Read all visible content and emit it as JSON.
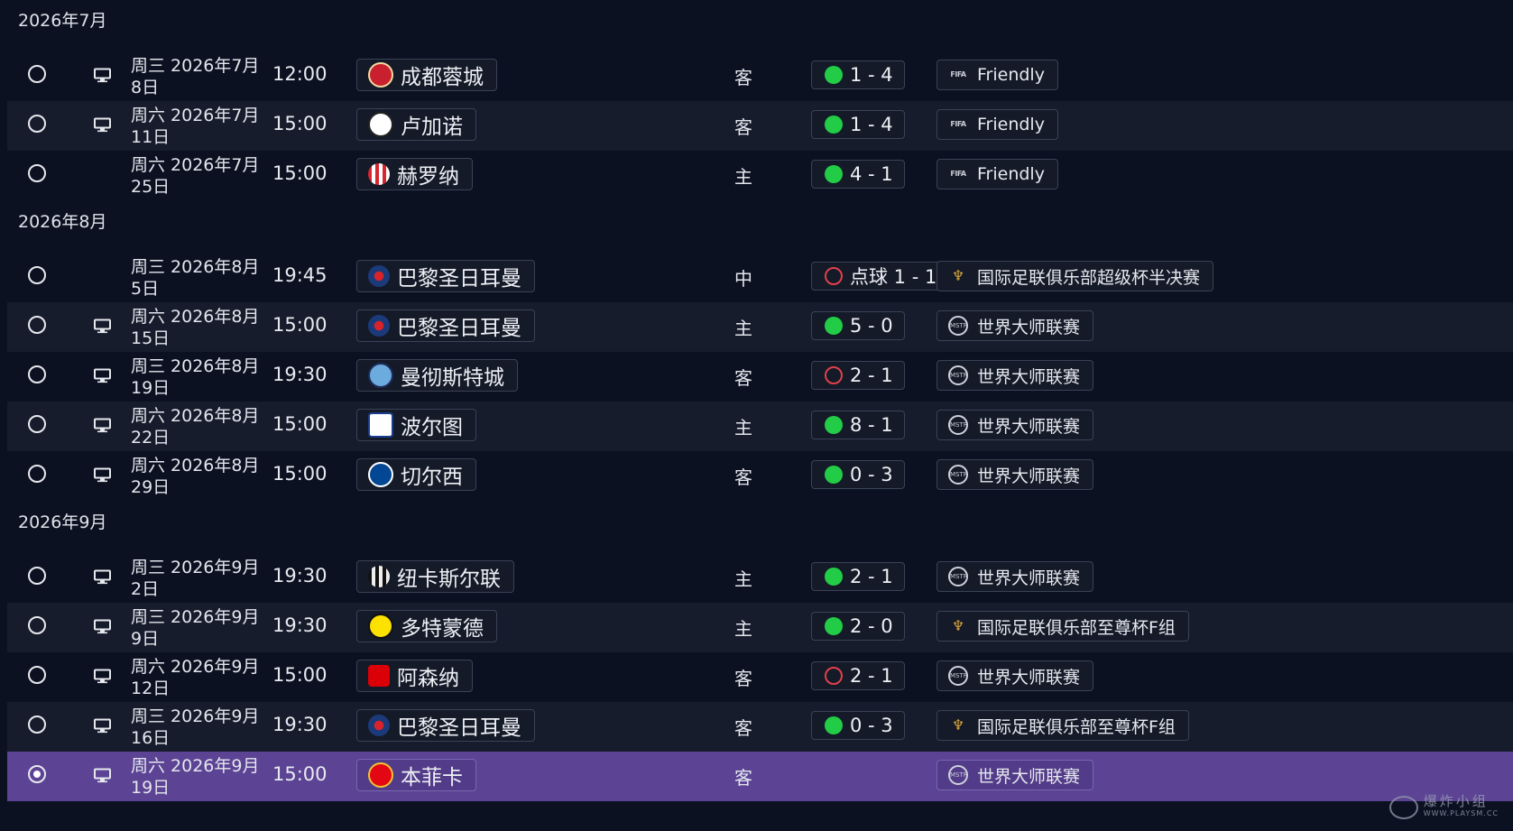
{
  "colors": {
    "win": "#22cc46",
    "loss": "#e0404c",
    "selected_row": "#5c4394",
    "background": "#0b1120"
  },
  "months": [
    {
      "label": "2026年7月",
      "matches": [
        {
          "date": "周三 2026年7月8日",
          "time": "12:00",
          "tv": true,
          "team": "成都蓉城",
          "crest": "chengdu-crest",
          "venue": "客",
          "result": "win",
          "score": "1 - 4",
          "competition": "Friendly",
          "comp_logo": "fifa"
        },
        {
          "date": "周六 2026年7月11日",
          "time": "15:00",
          "tv": true,
          "team": "卢加诺",
          "crest": "lugano-crest",
          "venue": "客",
          "result": "win",
          "score": "1 - 4",
          "competition": "Friendly",
          "comp_logo": "fifa"
        },
        {
          "date": "周六 2026年7月25日",
          "time": "15:00",
          "tv": false,
          "team": "赫罗纳",
          "crest": "girona-crest",
          "venue": "主",
          "result": "win",
          "score": "4 - 1",
          "competition": "Friendly",
          "comp_logo": "fifa"
        }
      ]
    },
    {
      "label": "2026年8月",
      "matches": [
        {
          "date": "周三 2026年8月5日",
          "time": "19:45",
          "tv": false,
          "team": "巴黎圣日耳曼",
          "crest": "psg-crest",
          "venue": "中",
          "result": "loss",
          "score": "点球 1 - 1",
          "competition": "国际足联俱乐部超级杯半决赛",
          "comp_logo": "trophy"
        },
        {
          "date": "周六 2026年8月15日",
          "time": "15:00",
          "tv": true,
          "team": "巴黎圣日耳曼",
          "crest": "psg-crest",
          "venue": "主",
          "result": "win",
          "score": "5 - 0",
          "competition": "世界大师联赛",
          "comp_logo": "masters"
        },
        {
          "date": "周三 2026年8月19日",
          "time": "19:30",
          "tv": true,
          "team": "曼彻斯特城",
          "crest": "mancity-crest",
          "venue": "客",
          "result": "loss",
          "score": "2 - 1",
          "competition": "世界大师联赛",
          "comp_logo": "masters"
        },
        {
          "date": "周六 2026年8月22日",
          "time": "15:00",
          "tv": true,
          "team": "波尔图",
          "crest": "porto-crest",
          "venue": "主",
          "result": "win",
          "score": "8 - 1",
          "competition": "世界大师联赛",
          "comp_logo": "masters"
        },
        {
          "date": "周六 2026年8月29日",
          "time": "15:00",
          "tv": true,
          "team": "切尔西",
          "crest": "chelsea-crest",
          "venue": "客",
          "result": "win",
          "score": "0 - 3",
          "competition": "世界大师联赛",
          "comp_logo": "masters"
        }
      ]
    },
    {
      "label": "2026年9月",
      "matches": [
        {
          "date": "周三 2026年9月2日",
          "time": "19:30",
          "tv": true,
          "team": "纽卡斯尔联",
          "crest": "newcastle-crest",
          "venue": "主",
          "result": "win",
          "score": "2 - 1",
          "competition": "世界大师联赛",
          "comp_logo": "masters"
        },
        {
          "date": "周三 2026年9月9日",
          "time": "19:30",
          "tv": true,
          "team": "多特蒙德",
          "crest": "dortmund-crest",
          "venue": "主",
          "result": "win",
          "score": "2 - 0",
          "competition": "国际足联俱乐部至尊杯F组",
          "comp_logo": "trophy"
        },
        {
          "date": "周六 2026年9月12日",
          "time": "15:00",
          "tv": true,
          "team": "阿森纳",
          "crest": "arsenal-crest",
          "venue": "客",
          "result": "loss",
          "score": "2 - 1",
          "competition": "世界大师联赛",
          "comp_logo": "masters"
        },
        {
          "date": "周三 2026年9月16日",
          "time": "19:30",
          "tv": true,
          "team": "巴黎圣日耳曼",
          "crest": "psg-crest",
          "venue": "客",
          "result": "win",
          "score": "0 - 3",
          "competition": "国际足联俱乐部至尊杯F组",
          "comp_logo": "trophy"
        },
        {
          "date": "周六 2026年9月19日",
          "time": "15:00",
          "tv": true,
          "team": "本菲卡",
          "crest": "benfica-crest",
          "venue": "客",
          "result": "none",
          "score": "",
          "competition": "世界大师联赛",
          "comp_logo": "masters",
          "selected": true
        }
      ]
    }
  ],
  "logo_text": {
    "fifa": "FIFA",
    "masters": "MSTR",
    "trophy": "♆"
  },
  "watermark": {
    "cn": "爆炸小组",
    "url": "WWW.PLAYSM.CC"
  }
}
